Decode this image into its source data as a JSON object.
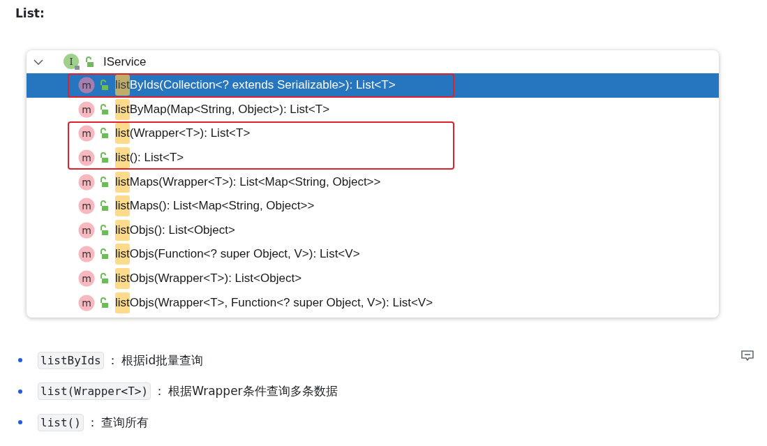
{
  "heading": "List:",
  "tree": {
    "root": {
      "label": "IService",
      "icon_letter": "I",
      "expanded": true
    },
    "methods": [
      {
        "icon_letter": "m",
        "match": "list",
        "rest": "ByIds(Collection<? extends Serializable>): List<T>",
        "selected": true,
        "outlined": true
      },
      {
        "icon_letter": "m",
        "match": "list",
        "rest": "ByMap(Map<String, Object>): List<T>",
        "selected": false,
        "outlined": false
      },
      {
        "icon_letter": "m",
        "match": "list",
        "rest": "(Wrapper<T>): List<T>",
        "selected": false,
        "outlined": true
      },
      {
        "icon_letter": "m",
        "match": "list",
        "rest": "(): List<T>",
        "selected": false,
        "outlined": true
      },
      {
        "icon_letter": "m",
        "match": "list",
        "rest": "Maps(Wrapper<T>): List<Map<String, Object>>",
        "selected": false,
        "outlined": false
      },
      {
        "icon_letter": "m",
        "match": "list",
        "rest": "Maps(): List<Map<String, Object>>",
        "selected": false,
        "outlined": false
      },
      {
        "icon_letter": "m",
        "match": "list",
        "rest": "Objs(): List<Object>",
        "selected": false,
        "outlined": false
      },
      {
        "icon_letter": "m",
        "match": "list",
        "rest": "Objs(Function<? super Object, V>): List<V>",
        "selected": false,
        "outlined": false
      },
      {
        "icon_letter": "m",
        "match": "list",
        "rest": "Objs(Wrapper<T>): List<Object>",
        "selected": false,
        "outlined": false
      },
      {
        "icon_letter": "m",
        "match": "list",
        "rest": "Objs(Wrapper<T>, Function<? super Object, V>): List<V>",
        "selected": false,
        "outlined": false
      }
    ]
  },
  "bullets": [
    {
      "code": "listByIds",
      "separator": "：",
      "text": "根据id批量查询"
    },
    {
      "code": "list(Wrapper<T>)",
      "separator": "：",
      "text": "根据Wrapper条件查询多条数据"
    },
    {
      "code": "list()",
      "separator": "：",
      "text": "查询所有"
    }
  ]
}
